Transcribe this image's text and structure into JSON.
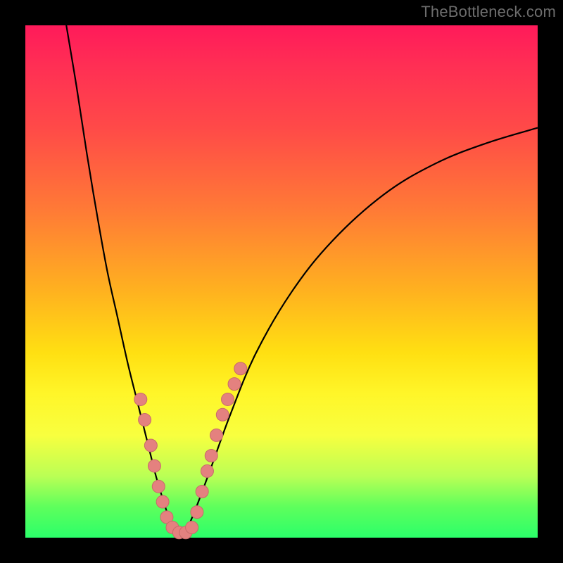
{
  "watermark": "TheBottleneck.com",
  "chart_data": {
    "type": "line",
    "title": "",
    "xlabel": "",
    "ylabel": "",
    "xlim": [
      0,
      100
    ],
    "ylim": [
      0,
      100
    ],
    "series": [
      {
        "name": "left-curve",
        "x": [
          8,
          10,
          12,
          14,
          16,
          18,
          20,
          22,
          24,
          25.5,
          27,
          28,
          29,
          30,
          31
        ],
        "y": [
          100,
          88,
          75,
          63,
          52,
          43,
          34,
          26,
          18,
          12,
          7,
          4,
          2,
          1,
          0.5
        ]
      },
      {
        "name": "right-curve",
        "x": [
          31,
          33,
          36,
          40,
          45,
          52,
          60,
          70,
          80,
          90,
          100
        ],
        "y": [
          0.5,
          5,
          13,
          24,
          36,
          48,
          58,
          67,
          73,
          77,
          80
        ]
      }
    ],
    "markers": {
      "name": "highlighted-points",
      "points": [
        {
          "x": 22.5,
          "y": 27
        },
        {
          "x": 23.3,
          "y": 23
        },
        {
          "x": 24.5,
          "y": 18
        },
        {
          "x": 25.2,
          "y": 14
        },
        {
          "x": 26.0,
          "y": 10
        },
        {
          "x": 26.8,
          "y": 7
        },
        {
          "x": 27.6,
          "y": 4
        },
        {
          "x": 28.7,
          "y": 2
        },
        {
          "x": 30.0,
          "y": 1
        },
        {
          "x": 31.3,
          "y": 1
        },
        {
          "x": 32.5,
          "y": 2
        },
        {
          "x": 33.5,
          "y": 5
        },
        {
          "x": 34.5,
          "y": 9
        },
        {
          "x": 35.5,
          "y": 13
        },
        {
          "x": 36.3,
          "y": 16
        },
        {
          "x": 37.3,
          "y": 20
        },
        {
          "x": 38.5,
          "y": 24
        },
        {
          "x": 39.5,
          "y": 27
        },
        {
          "x": 40.8,
          "y": 30
        },
        {
          "x": 42.0,
          "y": 33
        }
      ]
    },
    "gradient_stops": [
      {
        "pos": 0,
        "color": "#ff1a5a"
      },
      {
        "pos": 20,
        "color": "#ff4a48"
      },
      {
        "pos": 50,
        "color": "#ffb21f"
      },
      {
        "pos": 72,
        "color": "#fff629"
      },
      {
        "pos": 100,
        "color": "#2bff6a"
      }
    ]
  }
}
